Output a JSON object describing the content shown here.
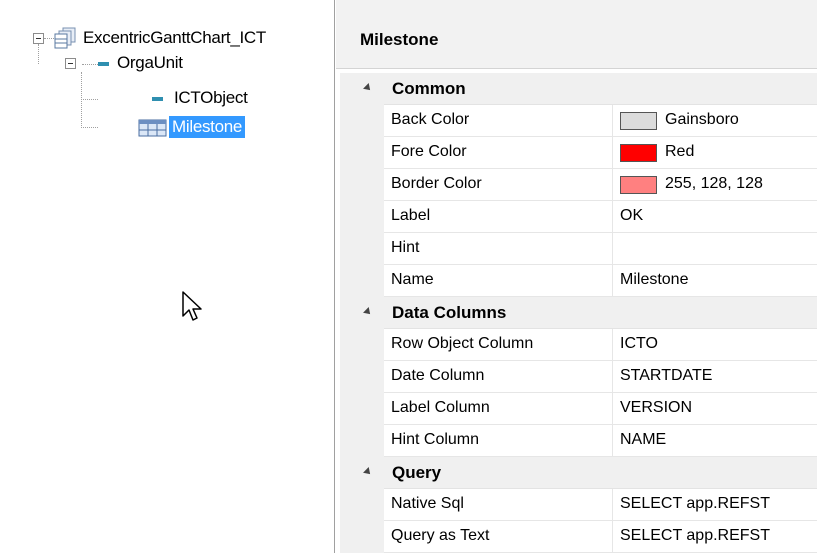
{
  "tree": {
    "root": {
      "label": "ExcentricGanttChart_ICT",
      "icon": "tables-icon"
    },
    "child": {
      "label": "OrgaUnit",
      "icon": "table-node-icon"
    },
    "grandchildren": [
      {
        "label": "ICTObject",
        "icon": "table-node-icon",
        "selected": false
      },
      {
        "label": "Milestone",
        "icon": "grid-icon",
        "selected": true
      }
    ]
  },
  "properties": {
    "title": "Milestone",
    "categories": [
      {
        "label": "Common",
        "rows": [
          {
            "name": "Back Color",
            "value": "Gainsboro",
            "swatch": "#dcdcdc"
          },
          {
            "name": "Fore Color",
            "value": "Red",
            "swatch": "#ff0000"
          },
          {
            "name": "Border Color",
            "value": "255, 128, 128",
            "swatch": "#ff8080"
          },
          {
            "name": "Label",
            "value": "OK"
          },
          {
            "name": "Hint",
            "value": ""
          },
          {
            "name": "Name",
            "value": "Milestone"
          }
        ]
      },
      {
        "label": "Data Columns",
        "rows": [
          {
            "name": "Row Object Column",
            "value": "ICTO"
          },
          {
            "name": "Date Column",
            "value": "STARTDATE"
          },
          {
            "name": "Label Column",
            "value": "VERSION"
          },
          {
            "name": "Hint Column",
            "value": "NAME"
          }
        ]
      },
      {
        "label": "Query",
        "rows": [
          {
            "name": "Native Sql",
            "value": "SELECT app.REFST"
          },
          {
            "name": "Query as Text",
            "value": "SELECT app.REFST"
          }
        ]
      }
    ]
  },
  "colors": {
    "selection": "#3399ff",
    "grid_category": "#f0f0f0",
    "header": "#f2f2f2"
  }
}
